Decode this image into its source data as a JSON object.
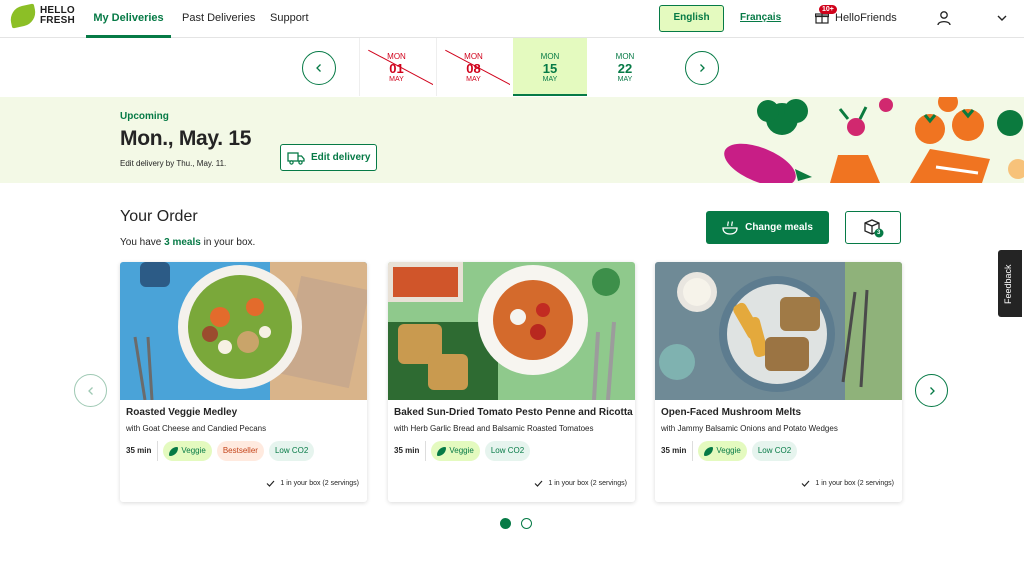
{
  "brand": {
    "logo_line1": "HELLO",
    "logo_line2": "FRESH"
  },
  "nav": {
    "tabs": [
      {
        "label": "My Deliveries",
        "active": true
      },
      {
        "label": "Past Deliveries",
        "active": false
      },
      {
        "label": "Support",
        "active": false
      }
    ],
    "lang_english": "English",
    "lang_french": "Français",
    "friends_badge": "10+",
    "friends_label": "HelloFriends"
  },
  "dates": [
    {
      "dow": "MON",
      "day": "01",
      "month": "MAY",
      "state": "past"
    },
    {
      "dow": "MON",
      "day": "08",
      "month": "MAY",
      "state": "past"
    },
    {
      "dow": "MON",
      "day": "15",
      "month": "MAY",
      "state": "active"
    },
    {
      "dow": "MON",
      "day": "22",
      "month": "MAY",
      "state": "future"
    }
  ],
  "banner": {
    "status": "Upcoming",
    "date": "Mon., May. 15",
    "edit_deadline": "Edit delivery by Thu., May. 11.",
    "edit_button": "Edit delivery"
  },
  "order": {
    "title": "Your Order",
    "meals_prefix": "You have ",
    "meals_count": "3 meals",
    "meals_suffix": " in your box.",
    "change_button": "Change meals",
    "box_count": "3"
  },
  "meals": [
    {
      "title": "Roasted Veggie Medley",
      "subtitle": "with Goat Cheese and Candied Pecans",
      "time": "35 min",
      "tags": [
        "Veggie",
        "Bestseller",
        "Low CO2"
      ],
      "in_box": "1 in your box (2 servings)"
    },
    {
      "title": "Baked Sun-Dried Tomato Pesto Penne and Ricotta",
      "subtitle": "with Herb Garlic Bread and Balsamic Roasted Tomatoes",
      "time": "35 min",
      "tags": [
        "Veggie",
        "Low CO2"
      ],
      "in_box": "1 in your box (2 servings)"
    },
    {
      "title": "Open-Faced Mushroom Melts",
      "subtitle": "with Jammy Balsamic Onions and Potato Wedges",
      "time": "35 min",
      "tags": [
        "Veggie",
        "Low CO2"
      ],
      "in_box": "1 in your box (2 servings)"
    }
  ],
  "feedback": "Feedback",
  "colors": {
    "brand_green": "#067a46",
    "light_green": "#e4fabf",
    "alert_red": "#d0021b"
  }
}
